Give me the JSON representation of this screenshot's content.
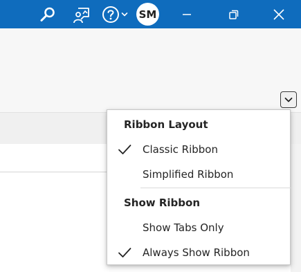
{
  "titlebar": {
    "background": "#0f6cbd",
    "icons": {
      "search": "search-icon",
      "coach": "coaching-icon",
      "help": "help-icon",
      "chevron": "chevron-down-icon",
      "minimize": "minimize-icon",
      "restore": "restore-icon",
      "close": "close-icon"
    },
    "avatar_initials": "SM"
  },
  "ribbon": {
    "toggle_icon": "chevron-down-icon"
  },
  "ribbon_options_menu": {
    "sections": [
      {
        "heading": "Ribbon Layout",
        "items": [
          {
            "label": "Classic Ribbon",
            "checked": true
          },
          {
            "label": "Simplified Ribbon",
            "checked": false
          }
        ]
      },
      {
        "heading": "Show Ribbon",
        "items": [
          {
            "label": "Show Tabs Only",
            "checked": false
          },
          {
            "label": "Always Show Ribbon",
            "checked": true
          }
        ]
      }
    ],
    "check_icon": "checkmark-icon"
  }
}
